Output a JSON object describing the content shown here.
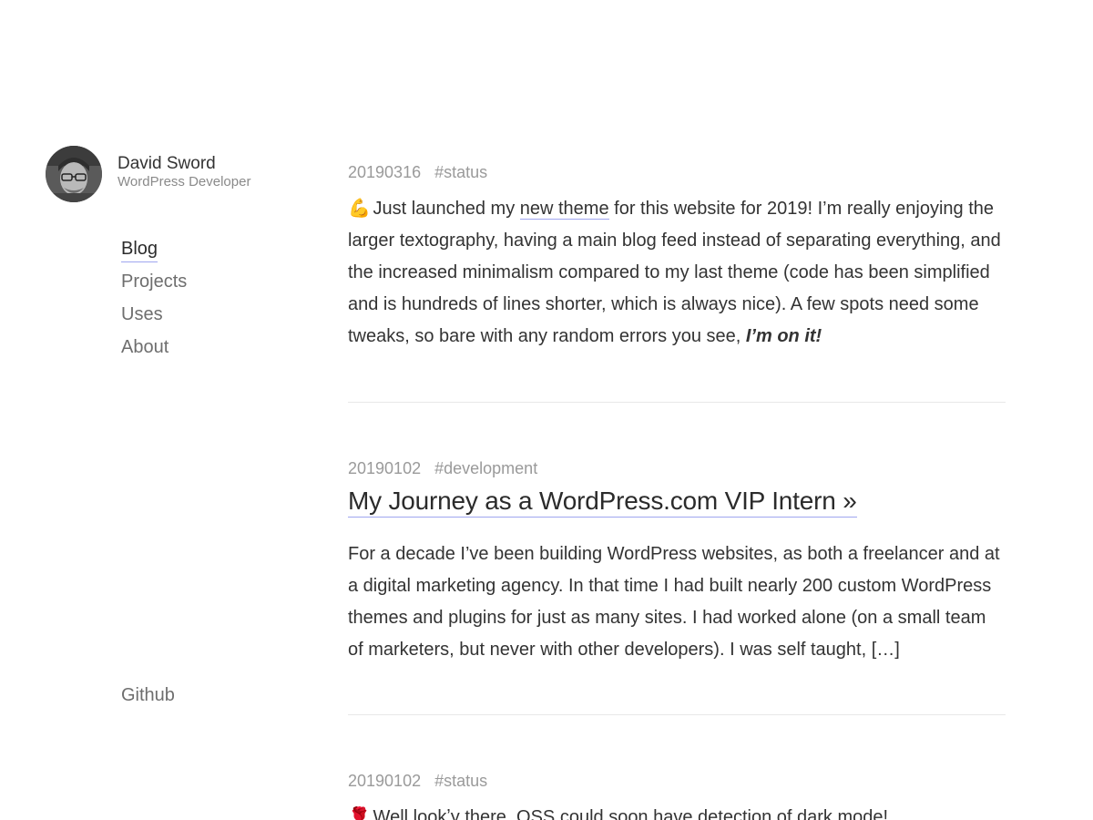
{
  "profile": {
    "name": "David Sword",
    "role": "WordPress Developer"
  },
  "nav": {
    "items": [
      {
        "label": "Blog",
        "active": true
      },
      {
        "label": "Projects"
      },
      {
        "label": "Uses"
      },
      {
        "label": "About"
      }
    ],
    "github_label": "Github"
  },
  "posts": [
    {
      "date": "20190316",
      "tag": "#status",
      "emoji": "💪",
      "text_before_link": " Just launched my ",
      "link_text": "new theme",
      "text_after_link": " for this website for 2019! I’m really enjoying the larger textography, having a main blog feed instead of separating everything, and the increased minimalism compared to my last theme (code has been simplified and is hundreds of lines shorter, which is always nice). A few spots need some tweaks, so bare with any random errors you see, ",
      "emphasis": "I’m on it!"
    },
    {
      "date": "20190102",
      "tag": "#development",
      "title": "My Journey as a WordPress.com VIP Intern »",
      "excerpt": "For a decade I’ve been building WordPress websites, as both a freelancer and at a digital marketing agency. In that time I had built nearly 200 custom WordPress themes and plugins for just as many sites. I had worked alone (on a small team of marketers, but never with other developers). I was self taught, […]"
    },
    {
      "date": "20190102",
      "tag": "#status",
      "emoji": "🌹",
      "text": " Well lookʼy there, OSS could soon have detection of dark mode!"
    }
  ],
  "colors": {
    "link_underline": "#9fa6f0",
    "meta": "#9a9a9a",
    "text": "#333333"
  }
}
